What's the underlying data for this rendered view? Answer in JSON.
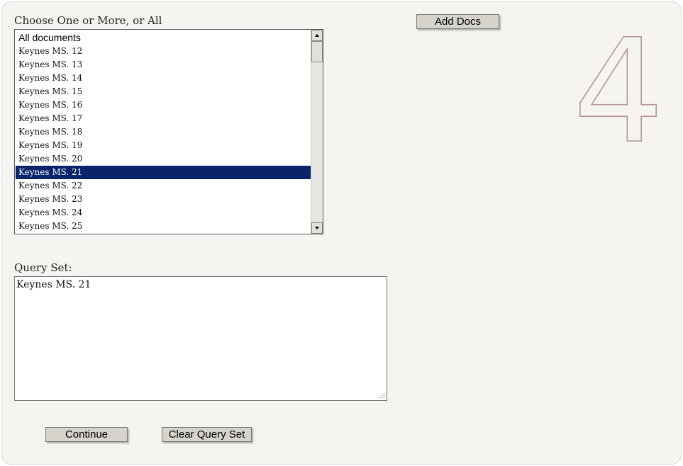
{
  "list": {
    "label": "Choose One or More, or All",
    "options": [
      "All documents",
      "Keynes MS. 12",
      "Keynes MS. 13",
      "Keynes MS. 14",
      "Keynes MS. 15",
      "Keynes MS. 16",
      "Keynes MS. 17",
      "Keynes MS. 18",
      "Keynes MS. 19",
      "Keynes MS. 20",
      "Keynes MS. 21",
      "Keynes MS. 22",
      "Keynes MS. 23",
      "Keynes MS. 24",
      "Keynes MS. 25"
    ],
    "selected": "Keynes MS. 21"
  },
  "add_button": "Add Docs",
  "step_number": "4",
  "query": {
    "label": "Query Set:",
    "value": "Keynes MS. 21"
  },
  "buttons": {
    "continue": "Continue",
    "clear": "Clear Query Set"
  },
  "colors": {
    "selection": "#0a246a",
    "step_outline": "#b79595",
    "panel": "#f5f4f0"
  }
}
